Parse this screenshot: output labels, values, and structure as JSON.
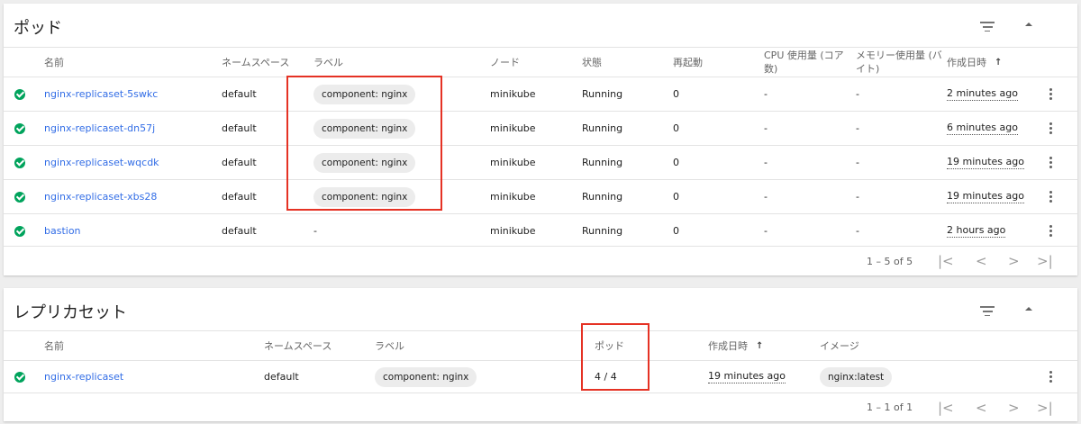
{
  "pods": {
    "title": "ポッド",
    "columns": {
      "name": "名前",
      "namespace": "ネームスペース",
      "labels": "ラベル",
      "node": "ノード",
      "status": "状態",
      "restarts": "再起動",
      "cpu_line1": "CPU 使用量 (コア",
      "cpu_line2": "数)",
      "memory_line1": "メモリー使用量 (バ",
      "memory_line2": "イト)",
      "created": "作成日時",
      "sort_arrow": "↑"
    },
    "rows": [
      {
        "name": "nginx-replicaset-5swkc",
        "namespace": "default",
        "label": "component: nginx",
        "node": "minikube",
        "status": "Running",
        "restarts": "0",
        "cpu": "-",
        "memory": "-",
        "created": "2 minutes ago"
      },
      {
        "name": "nginx-replicaset-dn57j",
        "namespace": "default",
        "label": "component: nginx",
        "node": "minikube",
        "status": "Running",
        "restarts": "0",
        "cpu": "-",
        "memory": "-",
        "created": "6 minutes ago"
      },
      {
        "name": "nginx-replicaset-wqcdk",
        "namespace": "default",
        "label": "component: nginx",
        "node": "minikube",
        "status": "Running",
        "restarts": "0",
        "cpu": "-",
        "memory": "-",
        "created": "19 minutes ago"
      },
      {
        "name": "nginx-replicaset-xbs28",
        "namespace": "default",
        "label": "component: nginx",
        "node": "minikube",
        "status": "Running",
        "restarts": "0",
        "cpu": "-",
        "memory": "-",
        "created": "19 minutes ago"
      },
      {
        "name": "bastion",
        "namespace": "default",
        "label": "-",
        "node": "minikube",
        "status": "Running",
        "restarts": "0",
        "cpu": "-",
        "memory": "-",
        "created": "2 hours ago"
      }
    ],
    "pagination": {
      "range": "1 – 5 of 5",
      "first": "|<",
      "prev": "<",
      "next": ">",
      "last": ">|"
    }
  },
  "replicasets": {
    "title": "レプリカセット",
    "columns": {
      "name": "名前",
      "namespace": "ネームスペース",
      "labels": "ラベル",
      "pods": "ポッド",
      "created": "作成日時",
      "sort_arrow": "↑",
      "image": "イメージ"
    },
    "rows": [
      {
        "name": "nginx-replicaset",
        "namespace": "default",
        "label": "component: nginx",
        "pods": "4 / 4",
        "created": "19 minutes ago",
        "image": "nginx:latest"
      }
    ],
    "pagination": {
      "range": "1 – 1 of 1",
      "first": "|<",
      "prev": "<",
      "next": ">",
      "last": ">|"
    }
  },
  "icons": {
    "filter": "filter-icon",
    "collapse": "collapse-icon",
    "status_ok": "check-circle-icon",
    "more": "more-vert-icon"
  },
  "colors": {
    "link": "#326de6",
    "status_ok": "#00a35c",
    "highlight": "#e53224",
    "chip_bg": "#ececec"
  }
}
